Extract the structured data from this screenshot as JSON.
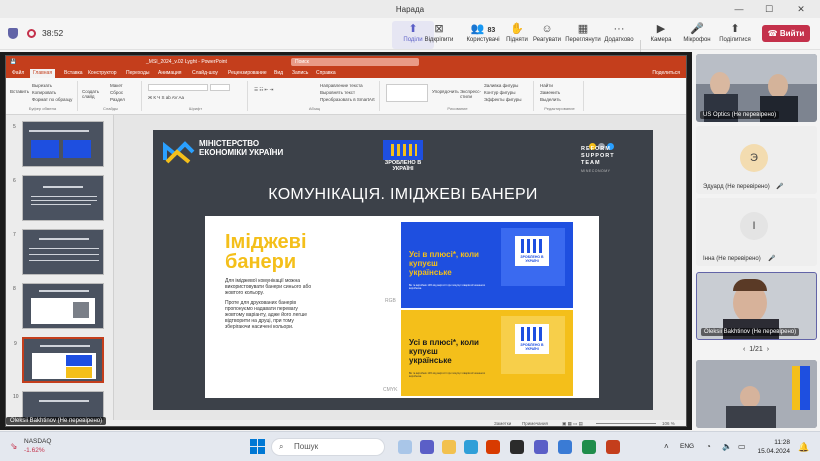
{
  "window": {
    "title": "Нарада",
    "timer": "38:52"
  },
  "toolbar": {
    "items": [
      {
        "label": "Поділи",
        "icon": "share-screen-icon"
      },
      {
        "label": "Відкріпити",
        "icon": "unpin-icon"
      },
      {
        "label": "Користувачі",
        "icon": "people-icon",
        "badge": "83"
      },
      {
        "label": "Підняти",
        "icon": "raise-hand-icon"
      },
      {
        "label": "Реагувати",
        "icon": "react-icon"
      },
      {
        "label": "Переглянути",
        "icon": "view-icon"
      },
      {
        "label": "Додатково",
        "icon": "more-icon"
      },
      {
        "label": "Камера",
        "icon": "camera-icon"
      },
      {
        "label": "Мікрофон",
        "icon": "mic-icon"
      },
      {
        "label": "Поділитися",
        "icon": "share-icon"
      }
    ],
    "leave_label": "Вийти"
  },
  "ppt": {
    "tabs": [
      "Файл",
      "Главная",
      "Вставка",
      "Конструктор",
      "Переходы",
      "Анимация",
      "Слайд-шоу",
      "Рецензирование",
      "Вид",
      "Запись",
      "Справка"
    ],
    "search_placeholder": "Поиск",
    "share_label": "Поделиться",
    "ribbon": {
      "paste": "Вставить",
      "cut": "Вырезать",
      "copy": "Копировать",
      "format": "Формат по образцу",
      "clipboard": "Буфер обмена",
      "new_slide": "Создать слайд",
      "reuse": "Повторно использовать слайды",
      "layout": "Макет",
      "reset": "Сброс",
      "section": "Раздел",
      "slides": "Слайды",
      "font": "Шрифт",
      "paragraph": "Абзац",
      "text_dir": "Направление текста",
      "align": "Выровнять текст",
      "smartart": "Преобразовать в SmartArt",
      "arrange": "Упорядочить",
      "quick_styles": "Экспресс-стили",
      "fill": "Заливка фигуры",
      "outline": "Контур фигуры",
      "effects": "Эффекты фигуры",
      "drawing": "Рисование",
      "find": "Найти",
      "replace": "Заменить",
      "select": "Выделить",
      "editing": "Редактирование"
    },
    "thumbs": [
      "5",
      "6",
      "7",
      "8",
      "9",
      "10"
    ],
    "status": {
      "notes": "Заметки",
      "comments": "Примечания",
      "zoom": "106 %"
    }
  },
  "slide": {
    "ministry": "МІНІСТЕРСТВО ЕКОНОМІКИ УКРАЇНИ",
    "made_in": "ЗРОБЛЕНО В УКРАЇНІ",
    "reform": "REFORM SUPPORT TEAM",
    "reform_sub": "MINECONOMY",
    "title": "КОМУНІКАЦІЯ. ІМІДЖЕВІ БАНЕРИ",
    "heading": "Іміджеві банери",
    "body_1": "Для іміджевої комунікації можна використовувати банери синього або жовтого кольору.",
    "body_2": "Проте для друкованих банерів пропонуємо надавати перевагу жовтому варіанту, адже його легше відтворити на друці, при тому зберігаючи насичені кольори.",
    "rgb_label": "RGB",
    "cmyk_label": "CMYK",
    "banner_slogan": "Усі в плюсі*, коли купуєш українське",
    "banner_fine": "Ви та виробник 10% від вартості при покупці товарів вітчизняного виробника",
    "banner_logo": "ЗРОБЛЕНО В УКРАЇНІ",
    "colors": {
      "blue": "#1e4fe0",
      "yellow": "#f4bf1a",
      "slide_bg": "#3c4149"
    }
  },
  "participants": [
    {
      "name": "US Optics (Не перевірено)",
      "type": "video"
    },
    {
      "name": "Эдуард (Не перевірено)",
      "initial": "Э"
    },
    {
      "name": "Інна (Не перевірено)",
      "initial": "І"
    },
    {
      "name": "Oleksii Bakhtinov (Не перевірено)",
      "type": "video"
    },
    {
      "name": "",
      "type": "video"
    }
  ],
  "pager": "1/21",
  "presenter": "Oleksii Bakhtinov (Не перевірено)",
  "taskbar": {
    "stock_name": "NASDAQ",
    "stock_change": "-1.62%",
    "search_placeholder": "Пошук",
    "lang": "ENG",
    "time": "11:28",
    "date": "15.04.2024"
  }
}
